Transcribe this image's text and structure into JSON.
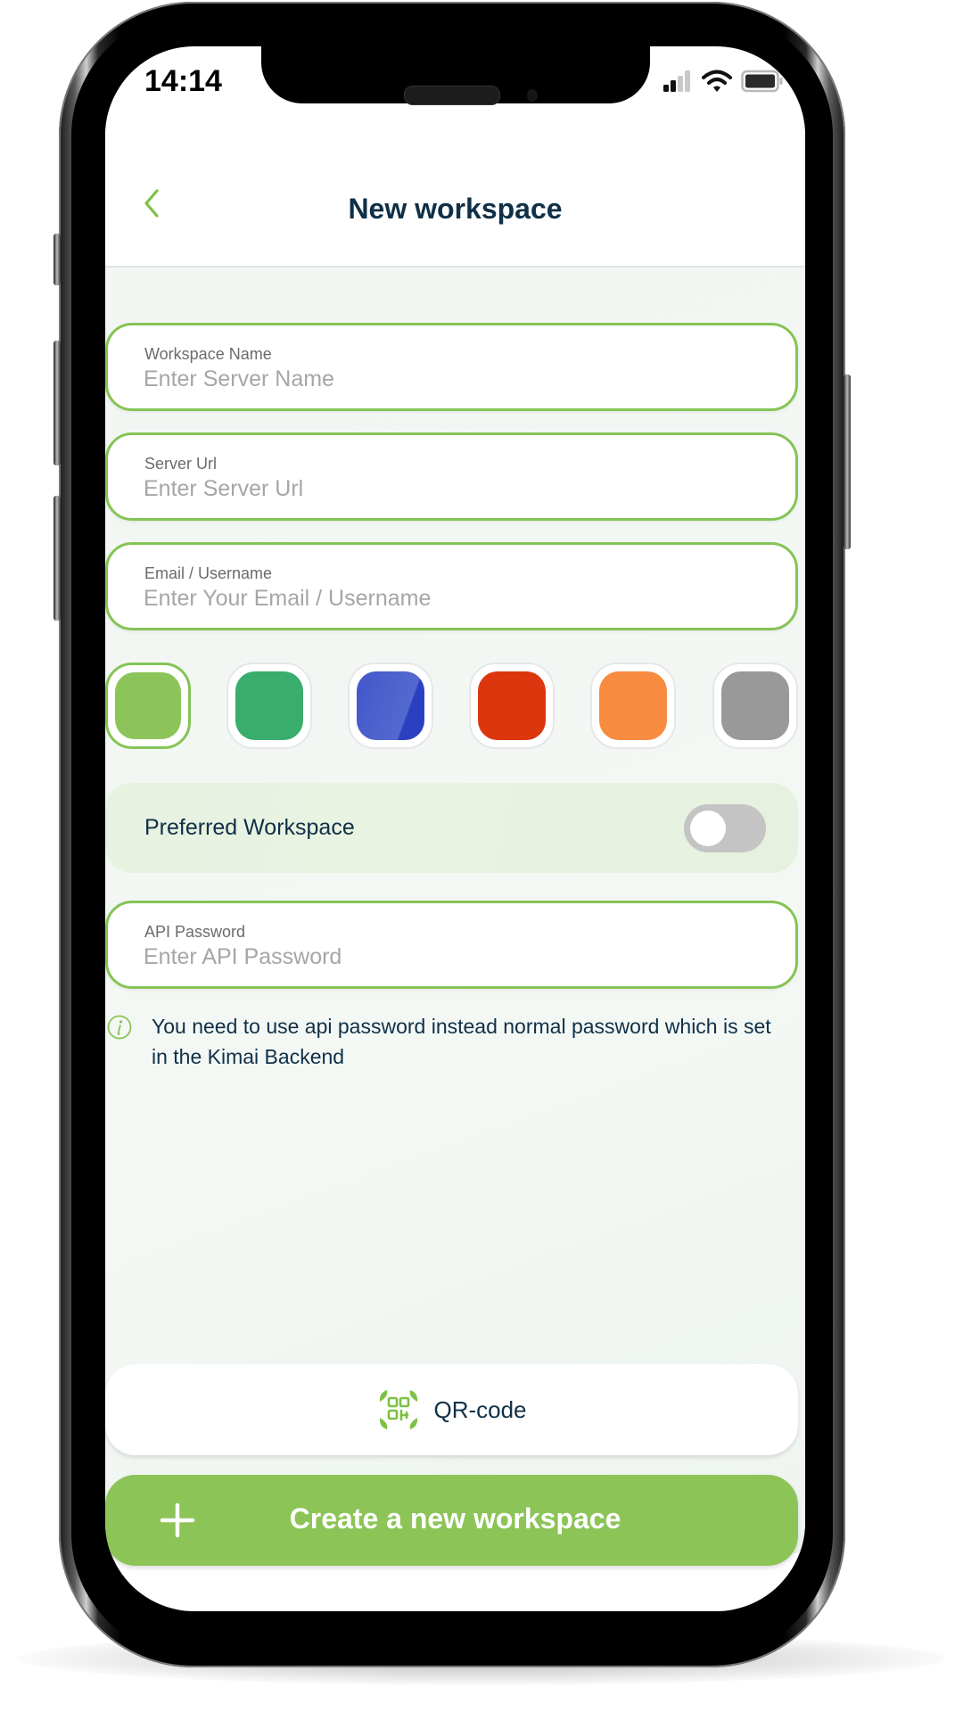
{
  "status_bar": {
    "time": "14:14",
    "icons": [
      "signal-icon",
      "wifi-icon",
      "battery-icon"
    ]
  },
  "header": {
    "back_icon": "chevron-left-icon",
    "title": "New workspace"
  },
  "form": {
    "workspace_name": {
      "label": "Workspace Name",
      "value": "",
      "placeholder": "Enter Server Name"
    },
    "server_url": {
      "label": "Server Url",
      "value": "",
      "placeholder": "Enter Server Url"
    },
    "email": {
      "label": "Email / Username",
      "value": "",
      "placeholder": "Enter Your Email / Username"
    },
    "api_password": {
      "label": "API Password",
      "value": "",
      "placeholder": "Enter API Password"
    }
  },
  "colors": {
    "accent": "#8cc457",
    "text_dark": "#0f3047",
    "swatches": [
      {
        "name": "light-green",
        "hex": "#8dc45a",
        "selected": true
      },
      {
        "name": "green",
        "hex": "#39ad6c",
        "selected": false
      },
      {
        "name": "blue",
        "hex": "#4257c9",
        "selected": false
      },
      {
        "name": "red",
        "hex": "#dc360e",
        "selected": false
      },
      {
        "name": "orange",
        "hex": "#f78c41",
        "selected": false
      },
      {
        "name": "gray",
        "hex": "#999999",
        "selected": false
      }
    ]
  },
  "preferred": {
    "label": "Preferred Workspace",
    "enabled": false
  },
  "info": {
    "icon": "info-icon",
    "text": "You need to use api password instead normal password which is set in the Kimai Backend"
  },
  "buttons": {
    "qr_label": "QR-code",
    "qr_icon": "qr-scan-icon",
    "create_label": "Create a new workspace",
    "create_icon": "plus-icon"
  }
}
